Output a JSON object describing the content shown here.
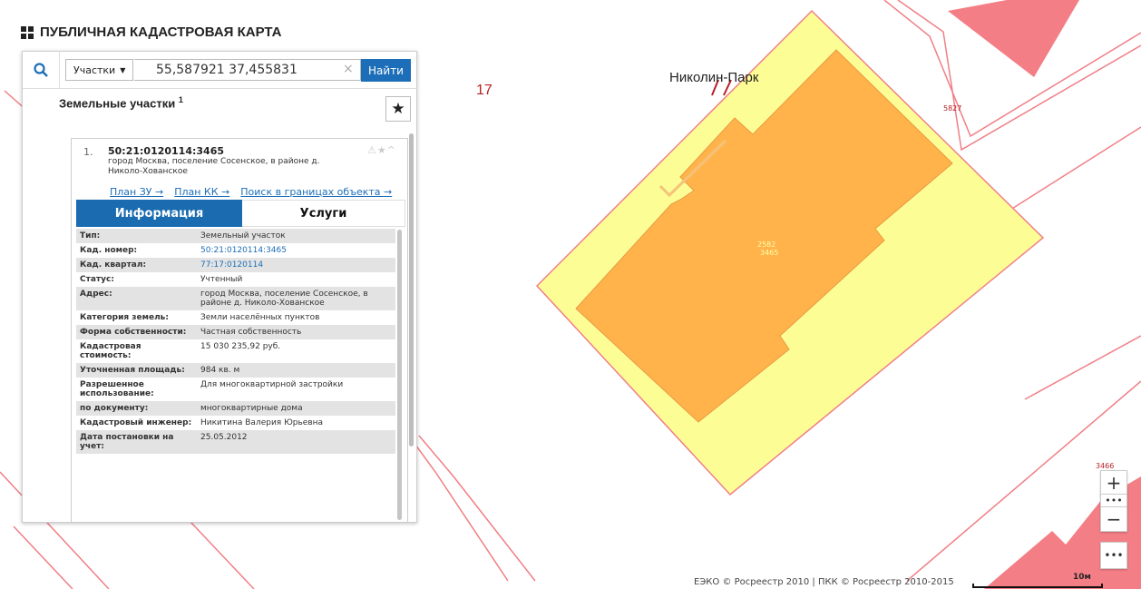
{
  "app": {
    "title": "ПУБЛИЧНАЯ КАДАСТРОВАЯ КАРТА"
  },
  "search": {
    "type_label": "Участки",
    "value": "55,587921 37,455831",
    "clear": "×",
    "find_label": "Найти"
  },
  "panel": {
    "section_title": "Земельные участки",
    "section_count": "1",
    "star": "★"
  },
  "result": {
    "number": "1.",
    "id": "50:21:0120114:3465",
    "address": "город Москва, поселение Сосенское, в районе д. Николо-Хованское",
    "icons": "⚠★^",
    "links": [
      "План ЗУ →",
      "План КК →",
      "Поиск в границах объекта →"
    ],
    "tabs": {
      "info": "Информация",
      "services": "Услуги"
    },
    "rows": [
      {
        "key": "Тип:",
        "value": "Земельный участок"
      },
      {
        "key": "Кад. номер:",
        "value": "50:21:0120114:3465"
      },
      {
        "key": "Кад. квартал:",
        "value": "77:17:0120114"
      },
      {
        "key": "Статус:",
        "value": "Учтенный"
      },
      {
        "key": "Адрес:",
        "value": "город Москва, поселение Сосенское, в районе д. Николо-Хованское"
      },
      {
        "key": "Категория земель:",
        "value": "Земли населённых пунктов"
      },
      {
        "key": "Форма собственности:",
        "value": "Частная собственность"
      },
      {
        "key": "Кадастровая стоимость:",
        "value": "15 030 235,92 руб."
      },
      {
        "key": "Уточненная площадь:",
        "value": "984 кв. м"
      },
      {
        "key": "Разрешенное использование:",
        "value": "Для многоквартирной застройки"
      },
      {
        "key": "по документу:",
        "value": "многоквартирные дома"
      },
      {
        "key": "Кадастровый инженер:",
        "value": "Никитина Валерия Юрьевна"
      },
      {
        "key": "Дата постановки на учет:",
        "value": "25.05.2012"
      }
    ]
  },
  "map": {
    "label_17": "17",
    "label_park": "Николин-Парк",
    "label_5827": "5827",
    "label_3465a": "2582",
    "label_3465b": "3465",
    "label_3466": "3466",
    "colors": {
      "parcel_fill": "#fdfd96",
      "building_fill": "#ffb34a",
      "boundary": "#f07f86",
      "neighbor_fill": "#f47e86"
    }
  },
  "controls": {
    "zoom_in": "+",
    "zoom_more": "•••",
    "zoom_out": "−",
    "more": "•••"
  },
  "footer": {
    "attribution": "ЕЭКО © Росреестр 2010 | ПКК © Росреестр 2010-2015",
    "scale": "10м"
  }
}
